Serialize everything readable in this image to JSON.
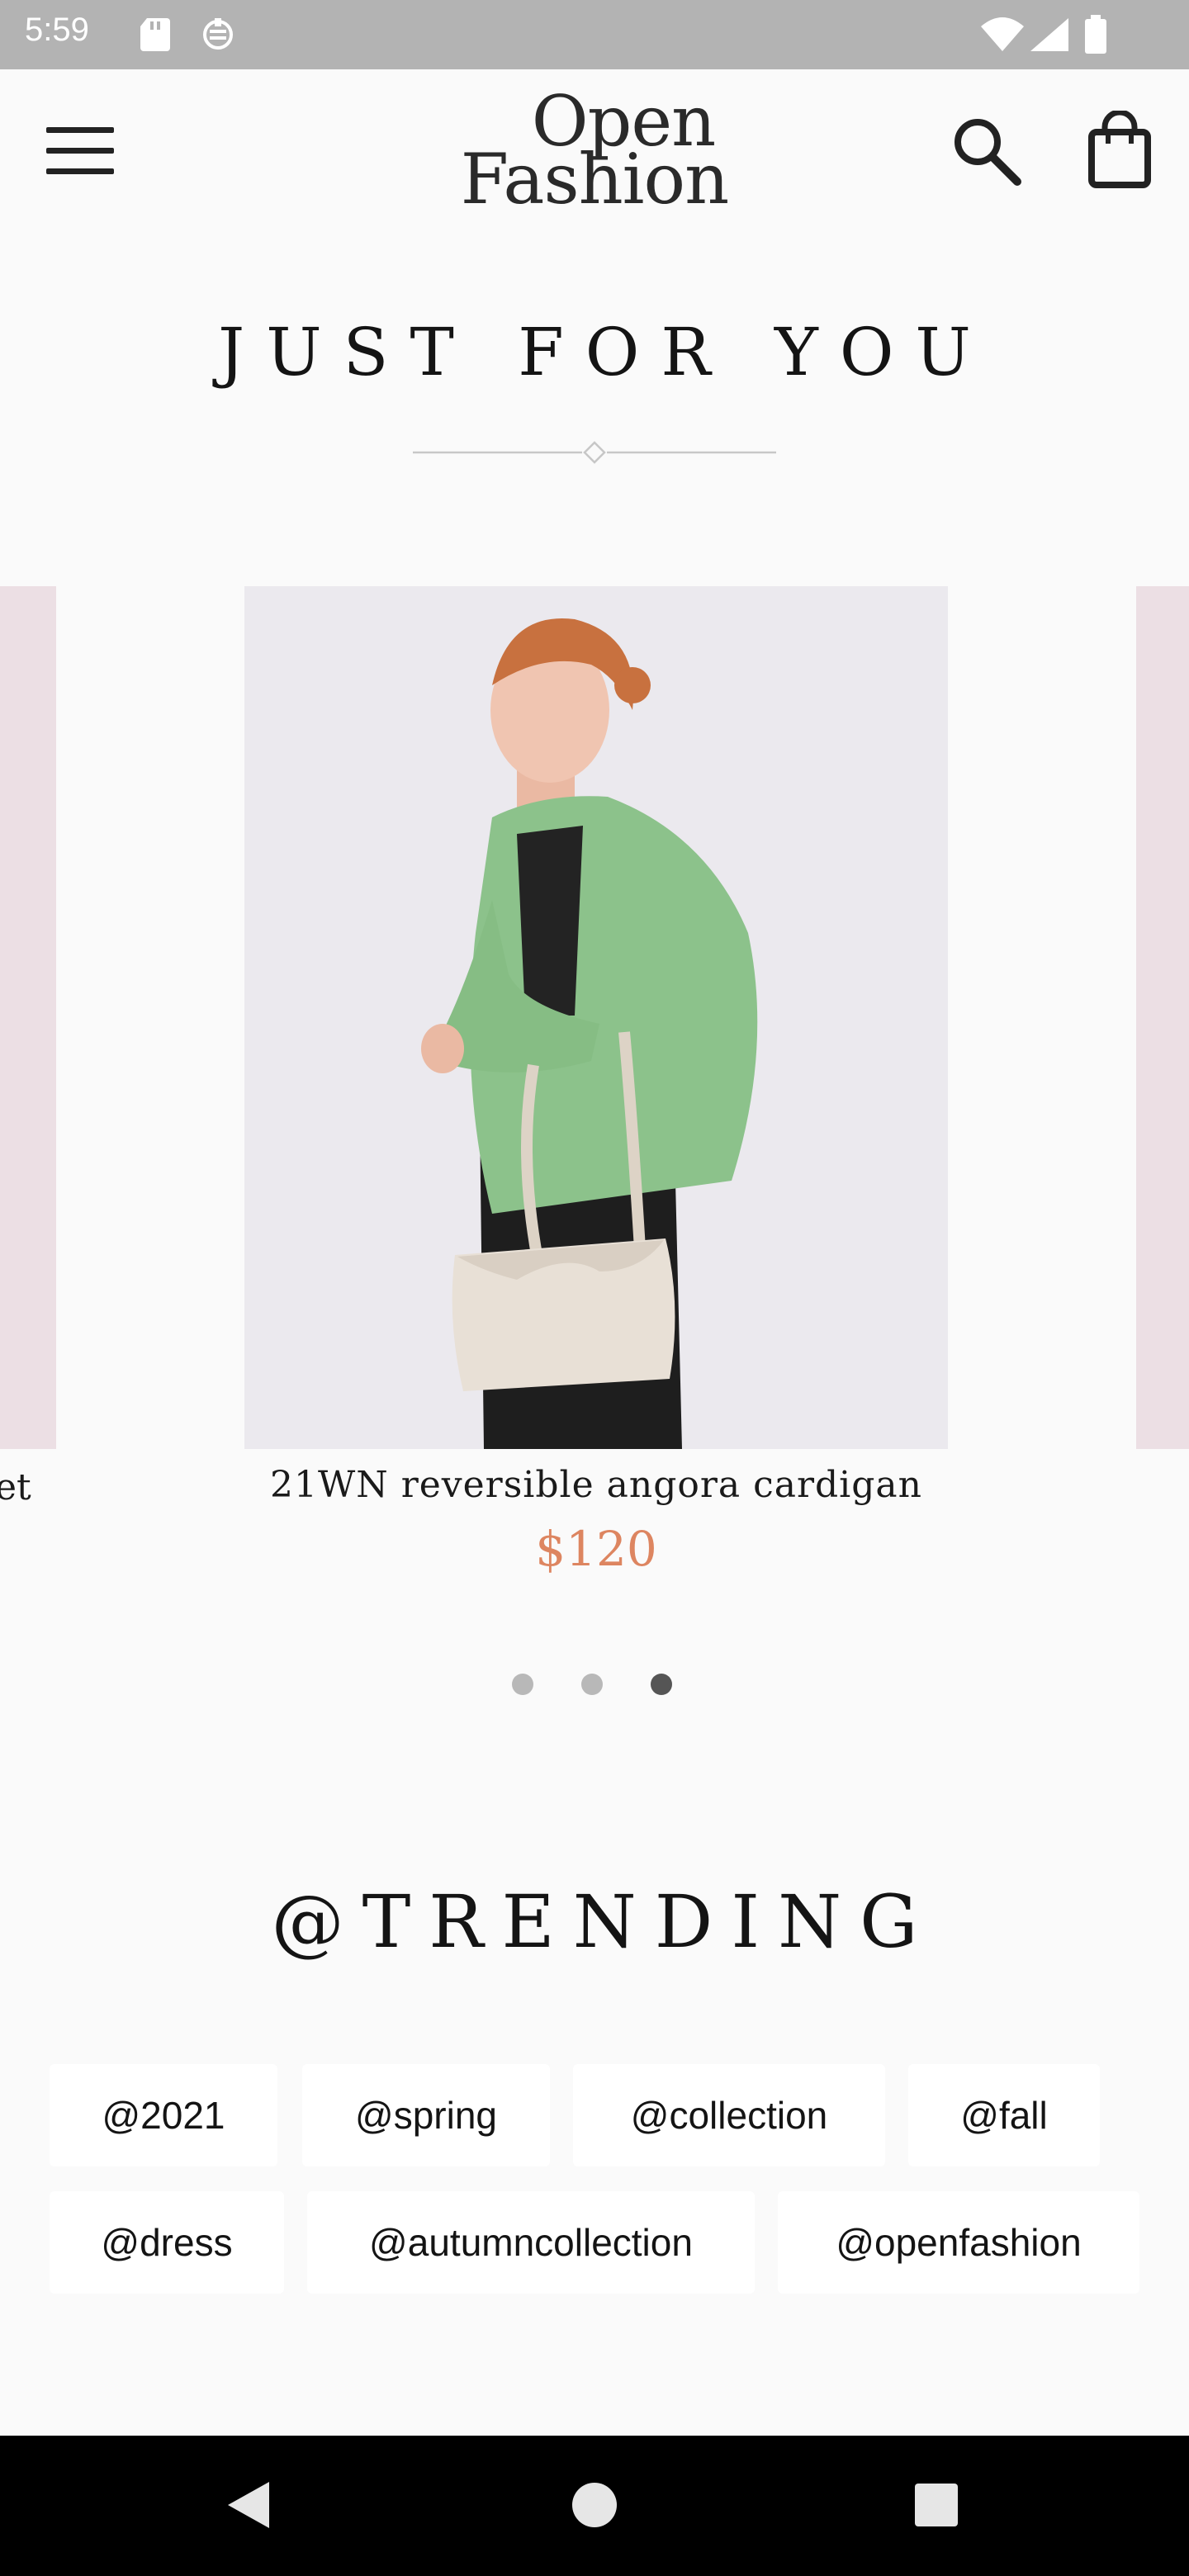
{
  "status_bar": {
    "time": "5:59",
    "icons": [
      "sd-card-icon",
      "download-icon",
      "wifi-icon",
      "signal-icon",
      "battery-icon"
    ]
  },
  "header": {
    "logo_line1": "Open",
    "logo_line2": "Fashion",
    "menu_icon": "menu-icon",
    "search_icon": "search-icon",
    "bag_icon": "shopping-bag-icon"
  },
  "just_for_you": {
    "title": "JUST FOR YOU",
    "side_caption_left": "et",
    "product": {
      "title": "21WN reversible angora cardigan",
      "price": "$120"
    },
    "pagination": {
      "count": 3,
      "active_index": 2
    }
  },
  "trending": {
    "title": "@TRENDING",
    "tags": [
      "@2021",
      "@spring",
      "@collection",
      "@fall",
      "@dress",
      "@autumncollection",
      "@openfashion"
    ]
  },
  "navigation_bar": {
    "icons": [
      "back-icon",
      "home-icon",
      "recents-icon"
    ]
  },
  "colors": {
    "accent_price": "#dd8560",
    "background": "#fafafa",
    "status_bar": "#b3b3b3",
    "tag_background": "#ffffff"
  }
}
